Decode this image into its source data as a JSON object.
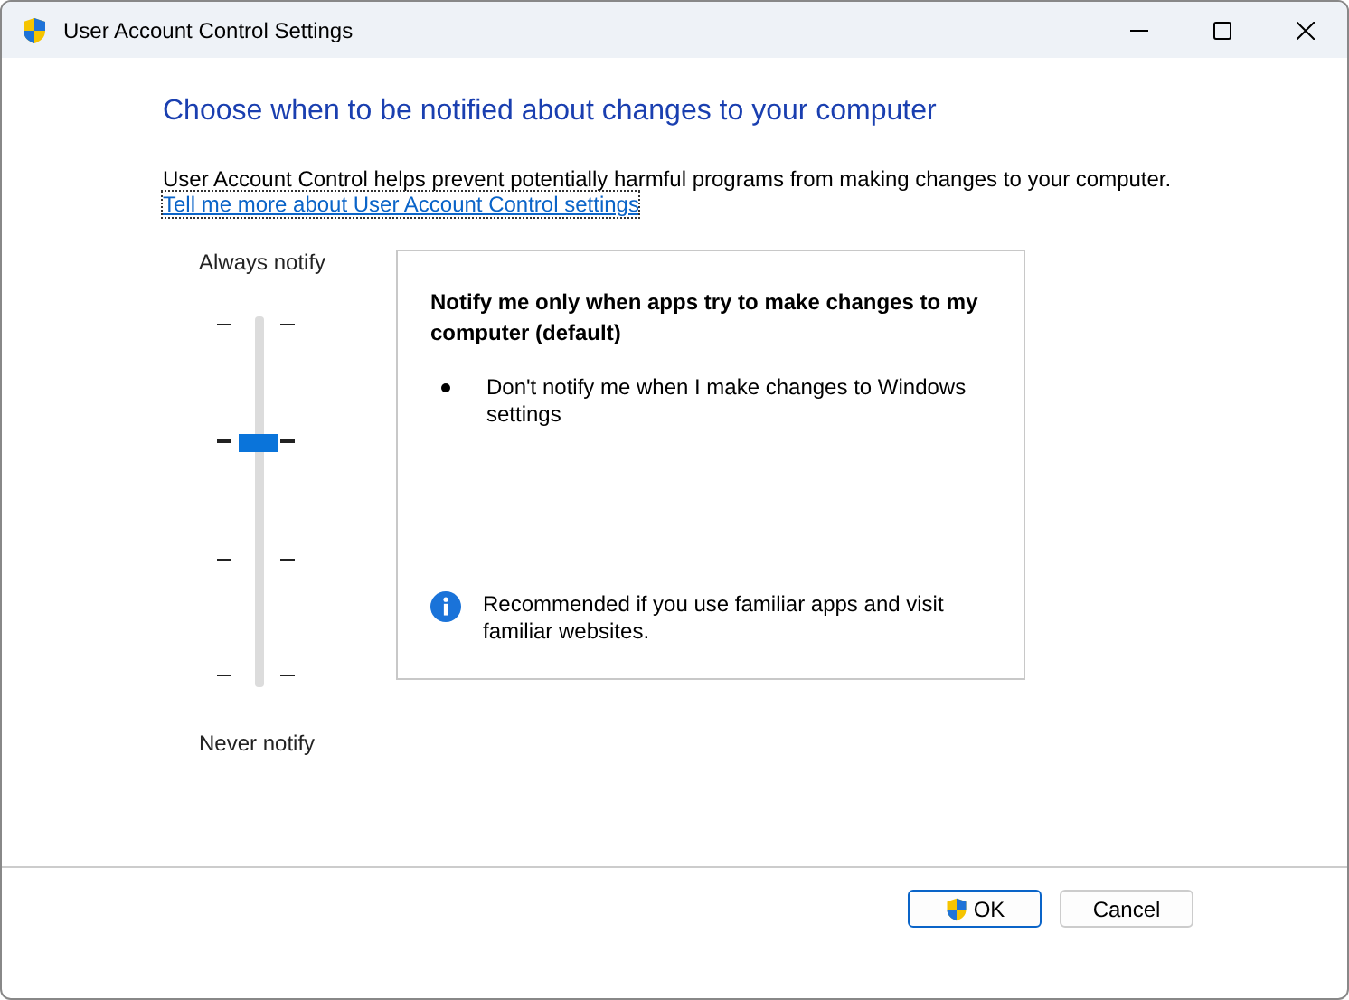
{
  "window": {
    "title": "User Account Control Settings"
  },
  "heading": "Choose when to be notified about changes to your computer",
  "description": "User Account Control helps prevent potentially harmful programs from making changes to your computer.",
  "link": "Tell me more about User Account Control settings",
  "slider": {
    "top_label": "Always notify",
    "bottom_label": "Never notify",
    "level": 0.667
  },
  "details": {
    "title": "Notify me only when apps try to make changes to my computer (default)",
    "bullets": [
      "Don't notify me when I make changes to Windows settings"
    ],
    "note": "Recommended if you use familiar apps and visit familiar websites."
  },
  "buttons": [
    {
      "label": "OK",
      "kind": "shield"
    },
    {
      "label": "Cancel",
      "kind": "plain"
    }
  ]
}
